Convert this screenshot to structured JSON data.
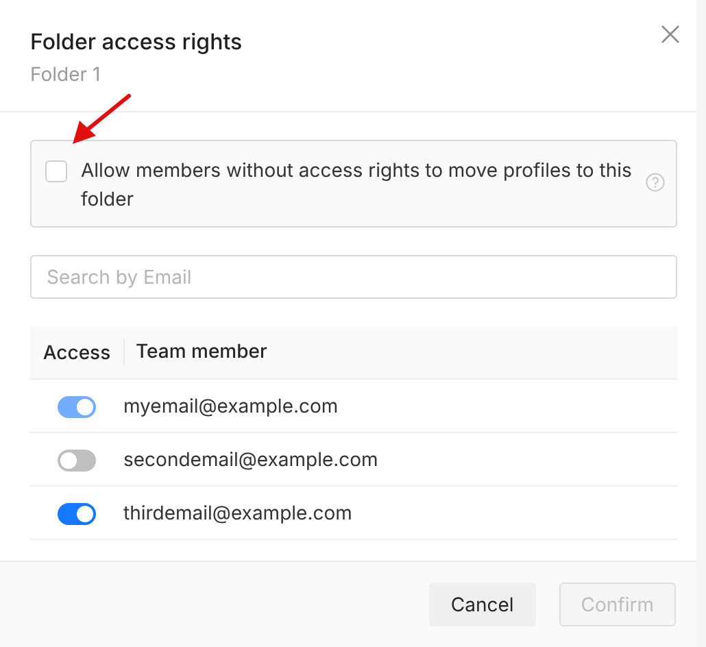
{
  "dialog": {
    "title": "Folder access rights",
    "subtitle": "Folder 1"
  },
  "option": {
    "label": "Allow members without access rights to move profiles to this folder",
    "checked": false
  },
  "search": {
    "placeholder": "Search by Email"
  },
  "table": {
    "columns": [
      "Access",
      "Team member"
    ],
    "rows": [
      {
        "on": true,
        "disabled": true,
        "email": "myemail@example.com"
      },
      {
        "on": false,
        "disabled": false,
        "email": "secondemail@example.com"
      },
      {
        "on": true,
        "disabled": false,
        "email": "thirdemail@example.com"
      }
    ]
  },
  "buttons": [
    {
      "label": "Cancel",
      "disabled": false
    },
    {
      "label": "Confirm",
      "disabled": true
    }
  ]
}
